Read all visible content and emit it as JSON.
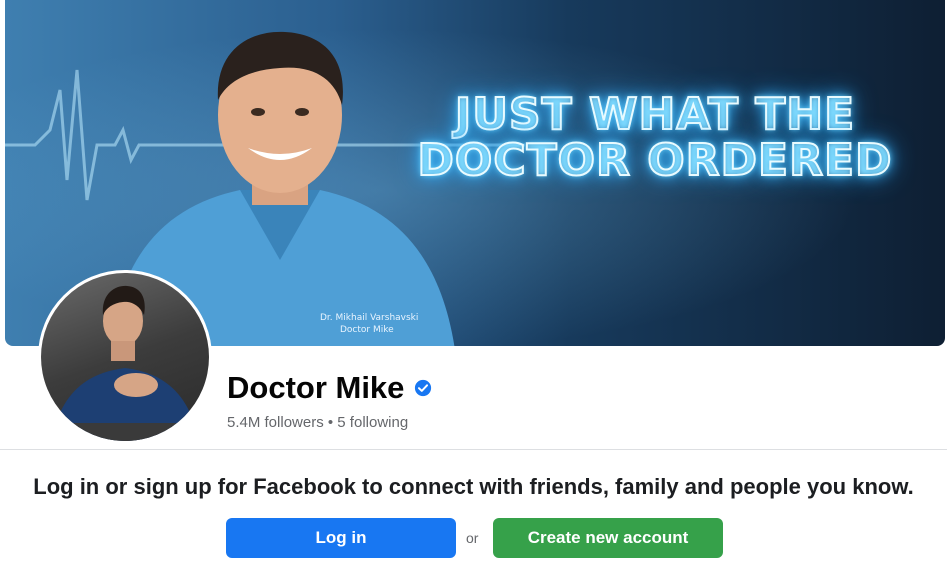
{
  "cover": {
    "headline": [
      "JUST WHAT THE",
      "DOCTOR ORDERED"
    ],
    "scrubs_text": [
      "Dr. Mikhail Varshavski",
      "Doctor Mike"
    ]
  },
  "profile": {
    "name": "Doctor Mike",
    "followers": "5.4M followers",
    "separator": " • ",
    "following": "5 following",
    "verified_icon": "verified-badge-icon"
  },
  "signup": {
    "prompt": "Log in or sign up for Facebook to connect with friends, family and people you know.",
    "login_label": "Log in",
    "or_label": "or",
    "create_label": "Create new account"
  },
  "colors": {
    "primary": "#1877f2",
    "create": "#36a14a",
    "verified": "#1877f2"
  }
}
